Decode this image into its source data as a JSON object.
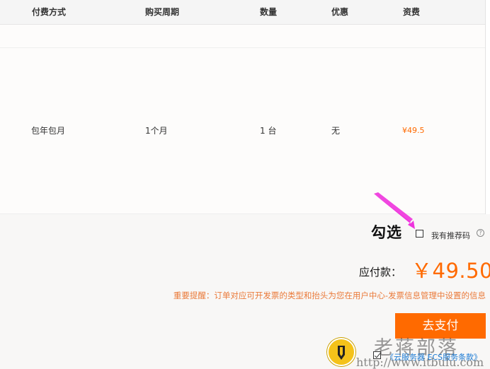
{
  "table": {
    "headers": [
      "付费方式",
      "购买周期",
      "数量",
      "优惠",
      "资费"
    ],
    "row": {
      "pay_method": "包年包月",
      "period": "1个月",
      "quantity": "1 台",
      "discount": "无",
      "price": "¥49.5"
    }
  },
  "annotation": {
    "label": "勾选",
    "arrow_color": "#ee33dd"
  },
  "referral": {
    "label": "我有推荐码",
    "checked": false,
    "help_icon": "question-icon"
  },
  "total": {
    "label": "应付款：",
    "amount": "￥49.50"
  },
  "notice": "重要提醒：订单对应可开发票的类型和抬头为您在用户中心-发票信息管理中设置的信息",
  "pay_button": {
    "label": "去支付",
    "color": "#ff6a00"
  },
  "terms": {
    "checked": true,
    "label": "《云服务器 ECS服务条款》"
  },
  "watermark": {
    "title": "老蒋部落",
    "url": "http://www.itbulu.com",
    "logo_icon": "pen-logo-icon"
  }
}
